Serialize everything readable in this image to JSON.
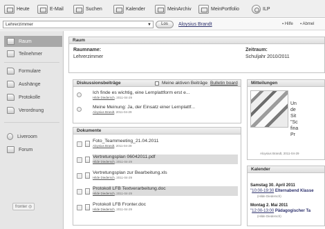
{
  "toolbar": {
    "items": [
      {
        "label": "Heute",
        "icon": "home-icon"
      },
      {
        "label": "E-Mail",
        "icon": "email-icon"
      },
      {
        "label": "Suchen",
        "icon": "search-icon"
      },
      {
        "label": "Kalender",
        "icon": "calendar-icon"
      },
      {
        "label": "MeinArchiv",
        "icon": "archive-icon"
      },
      {
        "label": "MeinPortfolio",
        "icon": "portfolio-icon"
      },
      {
        "label": "ILP",
        "icon": "ilp-icon"
      }
    ]
  },
  "roombar": {
    "selected_room": "Lehrerzimmer",
    "go_label": "Los",
    "user_name": "Aloysius Brandt",
    "help": "Hilfe",
    "logout": "Abmel"
  },
  "sidebar": {
    "items": [
      {
        "label": "Raum",
        "icon": "room-icon",
        "active": true
      },
      {
        "label": "Teilnehmer",
        "icon": "participants-icon",
        "active": false
      },
      {
        "label": "Formulare",
        "icon": "folder-icon",
        "active": false
      },
      {
        "label": "Aushänge",
        "icon": "folder-icon",
        "active": false
      },
      {
        "label": "Protokolle",
        "icon": "folder-icon",
        "active": false
      },
      {
        "label": "Verordnung",
        "icon": "folder-icon",
        "active": false
      },
      {
        "label": "Liveroom",
        "icon": "liveroom-icon",
        "active": false
      },
      {
        "label": "Forum",
        "icon": "forum-icon",
        "active": false
      }
    ],
    "logo": "fronter"
  },
  "raum": {
    "title": "Raum",
    "name_label": "Raumname:",
    "name_value": "Lehrerzimmer",
    "period_label": "Zeitraum:",
    "period_value": "Schuljahr 2010/2011"
  },
  "discussion": {
    "title": "Diskussionsbeiträge",
    "checkbox_label": "Meine aktiven Beiträge",
    "board_link": "Bulletin board",
    "posts": [
      {
        "title": "Ich finde es wichtig, eine Lernplattform erst e...",
        "author": "Hilde Diedersch",
        "date": ", 2011-04-29"
      },
      {
        "title": "Meine Meinung: Ja, der Einsatz einer Lernplattf...",
        "author": "Aloysius Brandt",
        "date": ", 2011-04-29"
      }
    ]
  },
  "documents": {
    "title": "Dokumente",
    "items": [
      {
        "title": "Foto_Teammeeting_21.04.2011",
        "author": "Aloysius Brandt",
        "date": ", 2011-04-29"
      },
      {
        "title": "Vertretungsplan 06042011.pdf",
        "author": "Hilde Diedersch",
        "date": ", 2011-04-29"
      },
      {
        "title": "Vertretungsplan zur Bearbeitung.xls",
        "author": "Hilde Diedersch",
        "date": ", 2011-04-29"
      },
      {
        "title": "Protokoll LFB Textverarbeitung.doc",
        "author": "Hilde Diedersch",
        "date": ", 2011-04-29"
      },
      {
        "title": "Protokoll LFB Fronter.doc",
        "author": "Hilde Diedersch",
        "date": ", 2011-04-29"
      }
    ]
  },
  "messages": {
    "title": "Mitteilungen",
    "text_lines": [
      "Un",
      "de",
      "Sit",
      "\"Sc",
      "fina",
      "Pr"
    ],
    "caption_author": "Aloysius Brandt",
    "caption_date": ", 2011-04-29"
  },
  "calendar": {
    "title": "Kalender",
    "days": [
      {
        "date": "Samstag 30. April 2011",
        "time": "10:00-19:30",
        "event": "Elternabend Klasse",
        "author": "(Hilde Diedersch)"
      },
      {
        "date": "Montag 2. Mai 2011",
        "time": "12:00-13:00",
        "event": "Pädagogischer Ta",
        "author": "(Hilde Diedersch)"
      }
    ]
  }
}
